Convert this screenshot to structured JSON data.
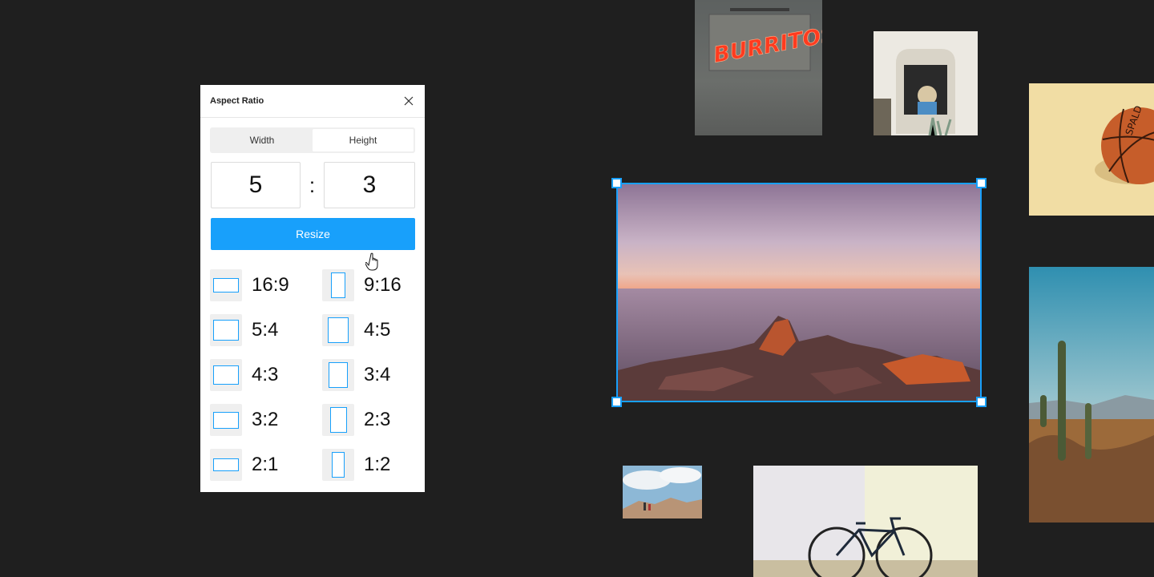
{
  "panel": {
    "title": "Aspect Ratio",
    "tabs": [
      {
        "label": "Width",
        "active": false
      },
      {
        "label": "Height",
        "active": true
      }
    ],
    "ratio": {
      "width": "5",
      "separator": ":",
      "height": "3"
    },
    "resize_label": "Resize",
    "presets": [
      {
        "label": "16:9"
      },
      {
        "label": "9:16"
      },
      {
        "label": "5:4"
      },
      {
        "label": "4:5"
      },
      {
        "label": "4:3"
      },
      {
        "label": "3:4"
      },
      {
        "label": "3:2"
      },
      {
        "label": "2:3"
      },
      {
        "label": "2:1"
      },
      {
        "label": "1:2"
      }
    ]
  },
  "canvas": {
    "neon_sign_text": "BURRITOS",
    "basketball_text": "SPALD",
    "accent_color": "#18a0fb",
    "background_color": "#1f1f1f"
  }
}
